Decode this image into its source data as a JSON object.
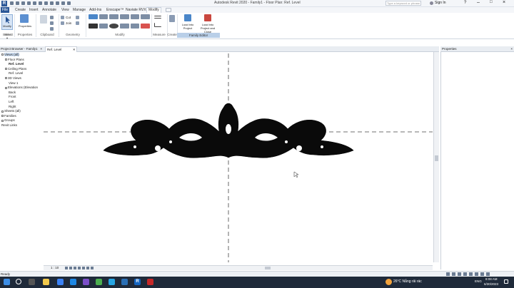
{
  "titlebar": {
    "title": "Autodesk Revit 2020 - Family1 - Floor Plan: Ref. Level",
    "search_placeholder": "Type a keyword or phrase",
    "sign_in": "Sign In"
  },
  "menu": {
    "file": "File",
    "tabs": [
      "Create",
      "Insert",
      "Annotate",
      "View",
      "Manage",
      "Add-Ins",
      "Enscape™",
      "Naviate RVX",
      "Modify"
    ]
  },
  "ribbon": {
    "modify_button": "Modify",
    "properties_button": "Properties",
    "groups": [
      "Select",
      "Properties",
      "Clipboard",
      "Geometry",
      "Modify",
      "Measure",
      "Create",
      "Family Editor"
    ],
    "select_label": "Select ▾",
    "cut": "Cut",
    "join": "Join",
    "load_into_project": "Load into Project",
    "load_into_project_close": "Load into Project and Close"
  },
  "project_browser": {
    "header": "Project Browser - Family1",
    "tree": [
      {
        "label": "Views (all)",
        "level": 0,
        "toggle": true,
        "selected": true
      },
      {
        "label": "Floor Plans",
        "level": 1,
        "toggle": true
      },
      {
        "label": "Ref. Level",
        "level": 2,
        "bold": true
      },
      {
        "label": "Ceiling Plans",
        "level": 1,
        "toggle": true
      },
      {
        "label": "Ref. Level",
        "level": 2
      },
      {
        "label": "3D Views",
        "level": 1,
        "toggle": true
      },
      {
        "label": "View 1",
        "level": 2
      },
      {
        "label": "Elevations (Elevation",
        "level": 1,
        "toggle": true
      },
      {
        "label": "Back",
        "level": 2
      },
      {
        "label": "Front",
        "level": 2
      },
      {
        "label": "Left",
        "level": 2
      },
      {
        "label": "Right",
        "level": 2
      },
      {
        "label": "Sheets (all)",
        "level": 0,
        "toggle": true
      },
      {
        "label": "Families",
        "level": 0,
        "toggle": true
      },
      {
        "label": "Groups",
        "level": 0,
        "toggle": true
      },
      {
        "label": "Revit Links",
        "level": 0
      }
    ]
  },
  "view_tab": {
    "label": "Ref. Level",
    "close": "×"
  },
  "properties": {
    "header": "Properties",
    "close": "×"
  },
  "view_control": {
    "scale": "1 : 10"
  },
  "status": {
    "text": "Ready"
  },
  "taskbar": {
    "weather": "26°C  Nắng rải rác",
    "lang": "ENG",
    "time": "8:08 AM",
    "date": "6/30/2023"
  },
  "colors": {
    "accent": "#2b5797",
    "family_editor": "#b9cfe8",
    "taskbar": "#1f2a3a"
  }
}
